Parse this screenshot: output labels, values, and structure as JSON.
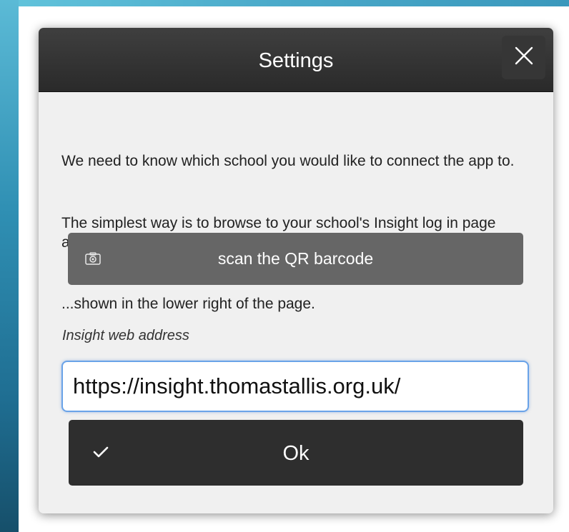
{
  "dialog": {
    "title": "Settings",
    "close_icon": "close-icon",
    "intro_text": "We need to know which school you would like to connect the app to.",
    "instruction_text": "The simplest way is to browse to your school's Insight log in page and...",
    "scan_button": {
      "label": "scan the QR barcode",
      "icon": "camera-icon"
    },
    "location_text": "...shown in the lower right of the page.",
    "address_field": {
      "label": "Insight web address",
      "value": "https://insight.thomastallis.org.uk/"
    },
    "ok_button": {
      "label": "Ok",
      "icon": "checkmark-icon"
    }
  },
  "colors": {
    "header_bg": "#2f2f2f",
    "dialog_bg": "#f0f0f0",
    "scan_button_bg": "#666666",
    "ok_button_bg": "#2e2e2e",
    "input_focus_border": "#6aa3e8"
  }
}
